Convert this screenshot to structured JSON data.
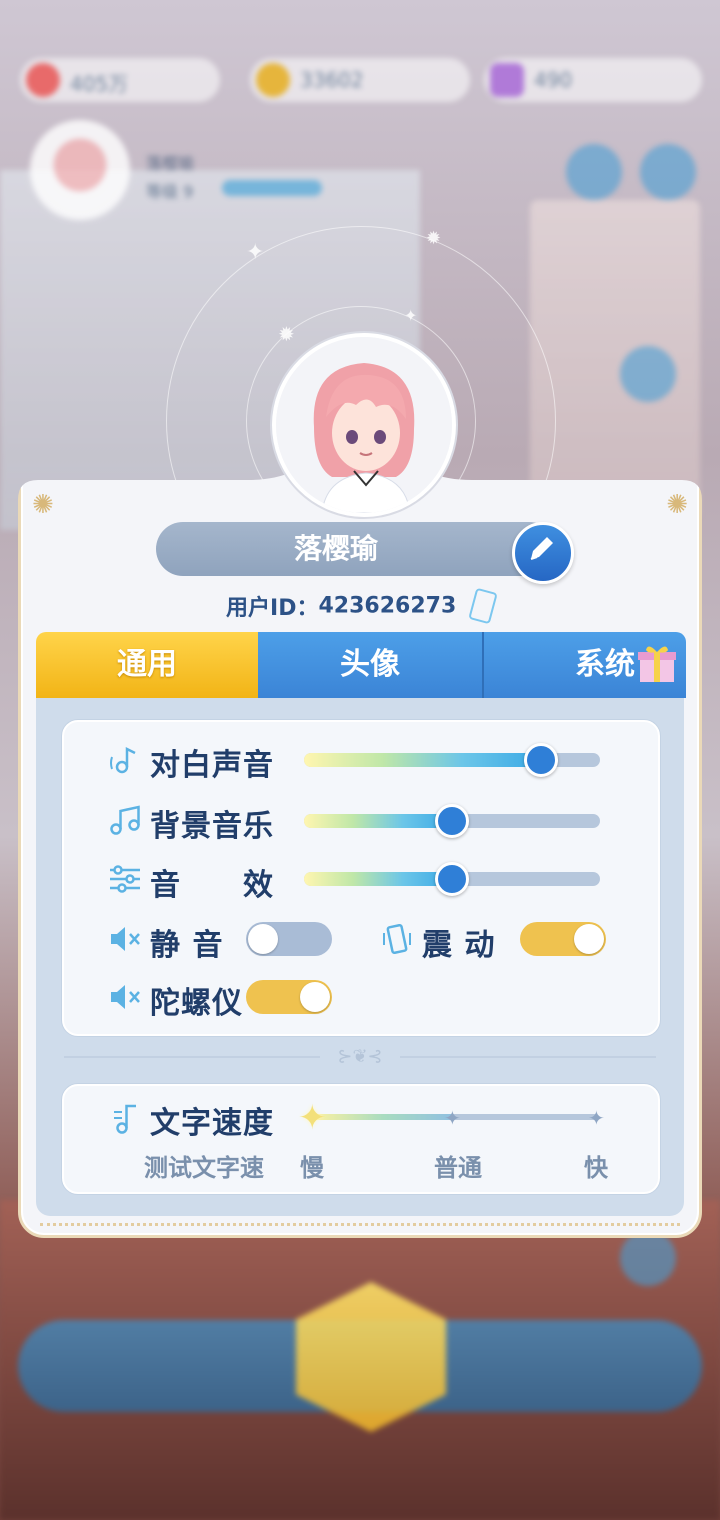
{
  "background": {
    "resources": [
      "405万",
      "33602",
      "490"
    ],
    "profile_name": "落樱瑜",
    "profile_level": "等级 9"
  },
  "profile": {
    "name": "落樱瑜",
    "uid_label": "用户ID：",
    "uid_value": "423626273"
  },
  "tabs": [
    {
      "label": "通用",
      "active": true
    },
    {
      "label": "头像",
      "active": false
    },
    {
      "label": "系统",
      "active": false
    }
  ],
  "audio": {
    "dialogue": {
      "label": "对白声音",
      "value": 0.8
    },
    "bgm": {
      "label": "背景音乐",
      "value": 0.5
    },
    "sfx": {
      "label": "音　　效",
      "value": 0.5
    }
  },
  "toggles": {
    "mute": {
      "label": "静 音",
      "on": false
    },
    "vibrate": {
      "label": "震 动",
      "on": true
    },
    "gyro": {
      "label": "陀螺仪",
      "on": true
    }
  },
  "text_speed": {
    "label": "文字速度",
    "preview": "测试文字速",
    "slow": "慢",
    "normal": "普通",
    "fast": "快",
    "value": 0
  },
  "colors": {
    "accent_blue": "#3b84d6",
    "accent_gold": "#f2b416",
    "text_dark": "#213e6a"
  }
}
